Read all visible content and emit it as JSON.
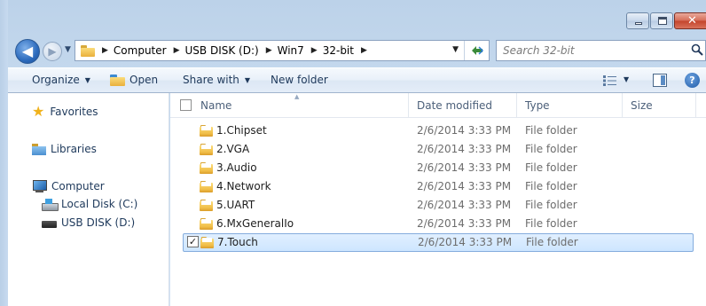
{
  "window": {
    "caption_close": "✕"
  },
  "navigation": {
    "back_glyph": "◀",
    "forward_glyph": "▶"
  },
  "address_bar": {
    "breadcrumbs": [
      "Computer",
      "USB DISK (D:)",
      "Win7",
      "32-bit"
    ]
  },
  "search": {
    "placeholder": "Search 32-bit"
  },
  "toolbar": {
    "organize_label": "Organize",
    "open_label": "Open",
    "share_with_label": "Share with",
    "new_folder_label": "New folder",
    "help_label": "?"
  },
  "nav_pane": {
    "favorites": "Favorites",
    "libraries": "Libraries",
    "computer": "Computer",
    "local_disk": "Local Disk (C:)",
    "usb_disk": "USB DISK (D:)"
  },
  "columns": {
    "name": "Name",
    "date_modified": "Date modified",
    "type": "Type",
    "size": "Size"
  },
  "files": [
    {
      "name": "1.Chipset",
      "date": "2/6/2014 3:33 PM",
      "type": "File folder",
      "selected": false
    },
    {
      "name": "2.VGA",
      "date": "2/6/2014 3:33 PM",
      "type": "File folder",
      "selected": false
    },
    {
      "name": "3.Audio",
      "date": "2/6/2014 3:33 PM",
      "type": "File folder",
      "selected": false
    },
    {
      "name": "4.Network",
      "date": "2/6/2014 3:33 PM",
      "type": "File folder",
      "selected": false
    },
    {
      "name": "5.UART",
      "date": "2/6/2014 3:33 PM",
      "type": "File folder",
      "selected": false
    },
    {
      "name": "6.MxGeneralIo",
      "date": "2/6/2014 3:33 PM",
      "type": "File folder",
      "selected": false
    },
    {
      "name": "7.Touch",
      "date": "2/6/2014 3:33 PM",
      "type": "File folder",
      "selected": true
    }
  ],
  "colors": {
    "accent": "#1e395b",
    "selection_fill": "#cde6ff",
    "selection_border": "#84acdd",
    "folder_yellow": "#f0bd47"
  }
}
